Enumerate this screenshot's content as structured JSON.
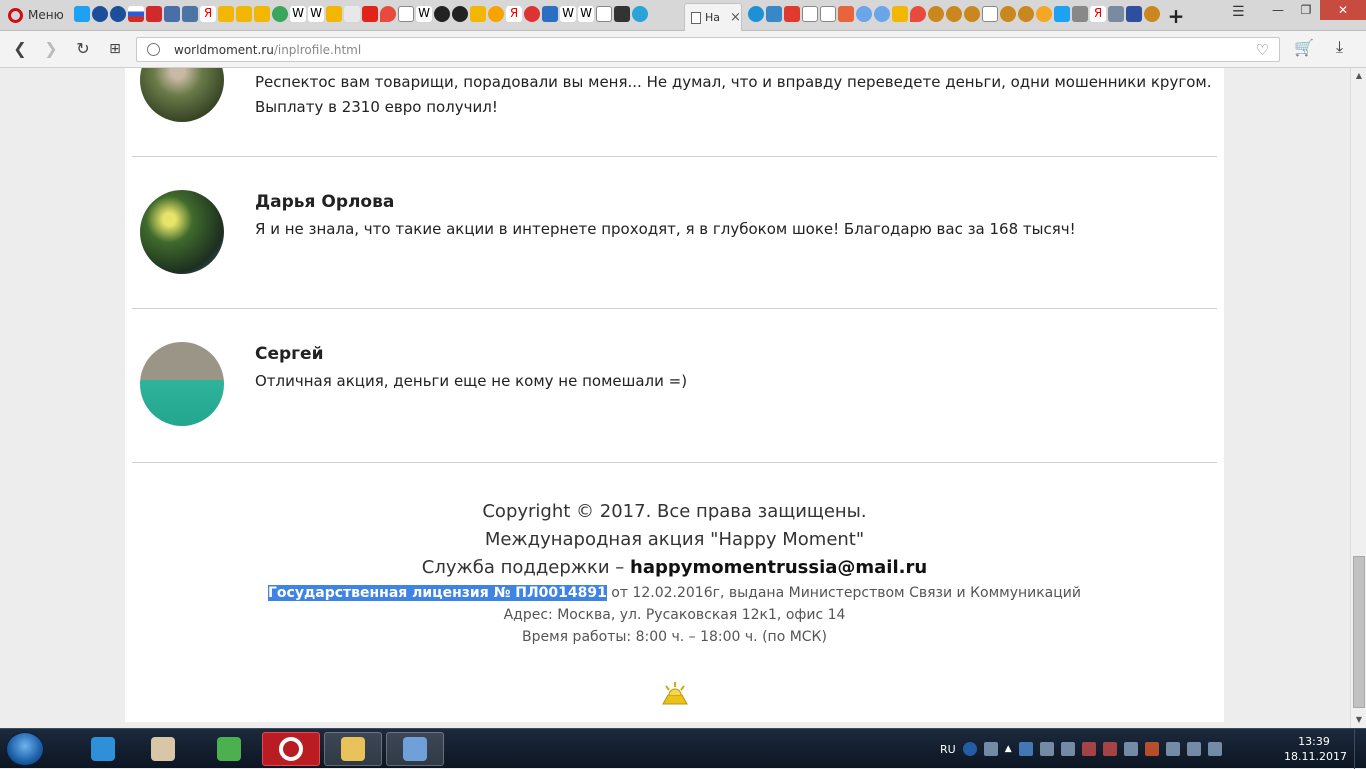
{
  "browser": {
    "menu_label": "Меню",
    "active_tab_title": "На",
    "active_tab_close": "×",
    "new_tab": "+",
    "url_host": "worldmoment.ru",
    "url_path": "/inplrofile.html"
  },
  "reviews": [
    {
      "name": "",
      "text": "Респектос вам товарищи, порадовали вы меня... Не думал, что и вправду переведете деньги, одни мошенники кругом. Выплату в 2310 евро получил!"
    },
    {
      "name": "Дарья Орлова",
      "text": "Я и не знала, что такие акции в интернете проходят, я в глубоком шоке! Благодарю вас за 168 тысяч!"
    },
    {
      "name": "Сергей",
      "text": "Отличная акция, деньги еще не кому не помешали =)"
    }
  ],
  "footer": {
    "copyright": "Copyright © 2017. Все права защищены.",
    "promo_name": "Международная акция \"Happy Moment\"",
    "support_prefix": "Служба поддержки – ",
    "support_email": "happymomentrussia@mail.ru",
    "license_selected": "Государственная лицензия № ПЛ0014891",
    "license_rest": " от 12.02.2016г, выдана Министерством Связи и Коммуникаций",
    "address": "Адрес: Москва, ул. Русаковская 12к1, офис 14",
    "hours": "Время работы: 8:00 ч. – 18:00 ч. (по МСК)"
  },
  "taskbar": {
    "language": "RU",
    "time": "13:39",
    "date": "18.11.2017"
  },
  "colors": {
    "selection": "#3f84e5",
    "opera_red": "#cc0f16",
    "taskbar": "#1c2a3d"
  }
}
